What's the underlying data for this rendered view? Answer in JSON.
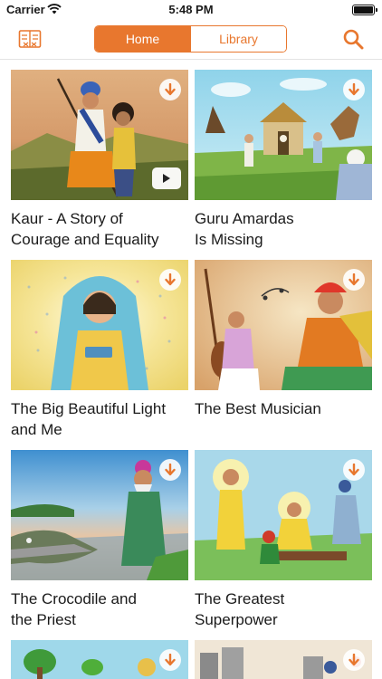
{
  "status_bar": {
    "carrier": "Carrier",
    "time": "5:48 PM"
  },
  "nav": {
    "tabs": [
      {
        "label": "Home",
        "selected": true
      },
      {
        "label": "Library",
        "selected": false
      }
    ],
    "accent_color": "#e8772e"
  },
  "stories": [
    {
      "title_lines": [
        "Kaur - A Story of",
        "Courage and Equality"
      ],
      "has_video": true
    },
    {
      "title_lines": [
        "Guru Amardas",
        "Is Missing"
      ],
      "has_video": false
    },
    {
      "title_lines": [
        "The Big Beautiful Light",
        "and Me"
      ],
      "has_video": false
    },
    {
      "title_lines": [
        "The Best Musician",
        ""
      ],
      "has_video": false
    },
    {
      "title_lines": [
        "The Crocodile and",
        "the Priest"
      ],
      "has_video": false
    },
    {
      "title_lines": [
        "The Greatest",
        "Superpower"
      ],
      "has_video": false
    },
    {
      "title_lines": [
        "",
        ""
      ],
      "has_video": false
    },
    {
      "title_lines": [
        "",
        ""
      ],
      "has_video": false
    }
  ],
  "icons": {
    "logo": "book-icon",
    "search": "search-icon",
    "download": "download-arrow-icon",
    "play": "play-icon"
  }
}
